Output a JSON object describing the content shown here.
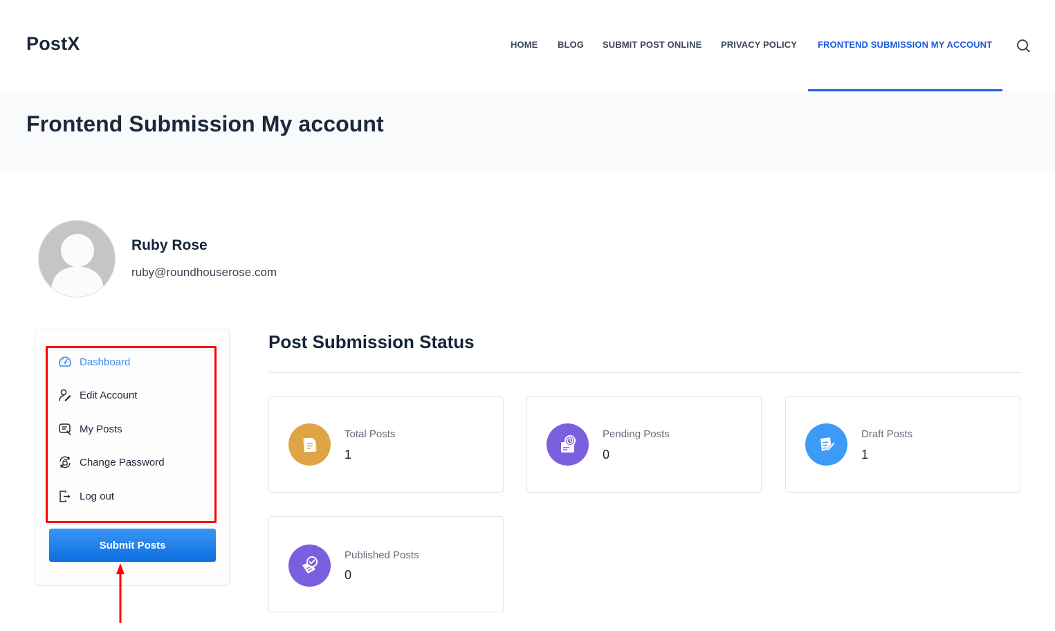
{
  "header": {
    "logo": "PostX",
    "nav": [
      {
        "label": "HOME",
        "active": false
      },
      {
        "label": "BLOG",
        "active": false
      },
      {
        "label": "SUBMIT POST ONLINE",
        "active": false
      },
      {
        "label": "PRIVACY POLICY",
        "active": false
      },
      {
        "label": "FRONTEND SUBMISSION MY ACCOUNT",
        "active": true
      }
    ],
    "search_icon": "search-icon",
    "accent_color": "#1d5bdb"
  },
  "page": {
    "title": "Frontend Submission My account"
  },
  "profile": {
    "name": "Ruby Rose",
    "email": "ruby@roundhouserose.com"
  },
  "sidebar": {
    "items": [
      {
        "label": "Dashboard",
        "icon": "dashboard-gauge-icon",
        "active": true
      },
      {
        "label": "Edit Account",
        "icon": "user-edit-icon",
        "active": false
      },
      {
        "label": "My Posts",
        "icon": "posts-list-icon",
        "active": false
      },
      {
        "label": "Change Password",
        "icon": "lock-refresh-icon",
        "active": false
      },
      {
        "label": "Log out",
        "icon": "logout-icon",
        "active": false
      }
    ],
    "submit_button": "Submit Posts"
  },
  "main": {
    "section_title": "Post Submission Status",
    "cards": [
      {
        "label": "Total Posts",
        "value": "1",
        "icon": "document-icon",
        "color": "#dfa446"
      },
      {
        "label": "Pending Posts",
        "value": "0",
        "icon": "pending-clock-icon",
        "color": "#7a5fdf"
      },
      {
        "label": "Draft Posts",
        "value": "1",
        "icon": "draft-edit-icon",
        "color": "#3b9bf7"
      },
      {
        "label": "Published Posts",
        "value": "0",
        "icon": "published-check-icon",
        "color": "#7a5fdf"
      }
    ]
  }
}
